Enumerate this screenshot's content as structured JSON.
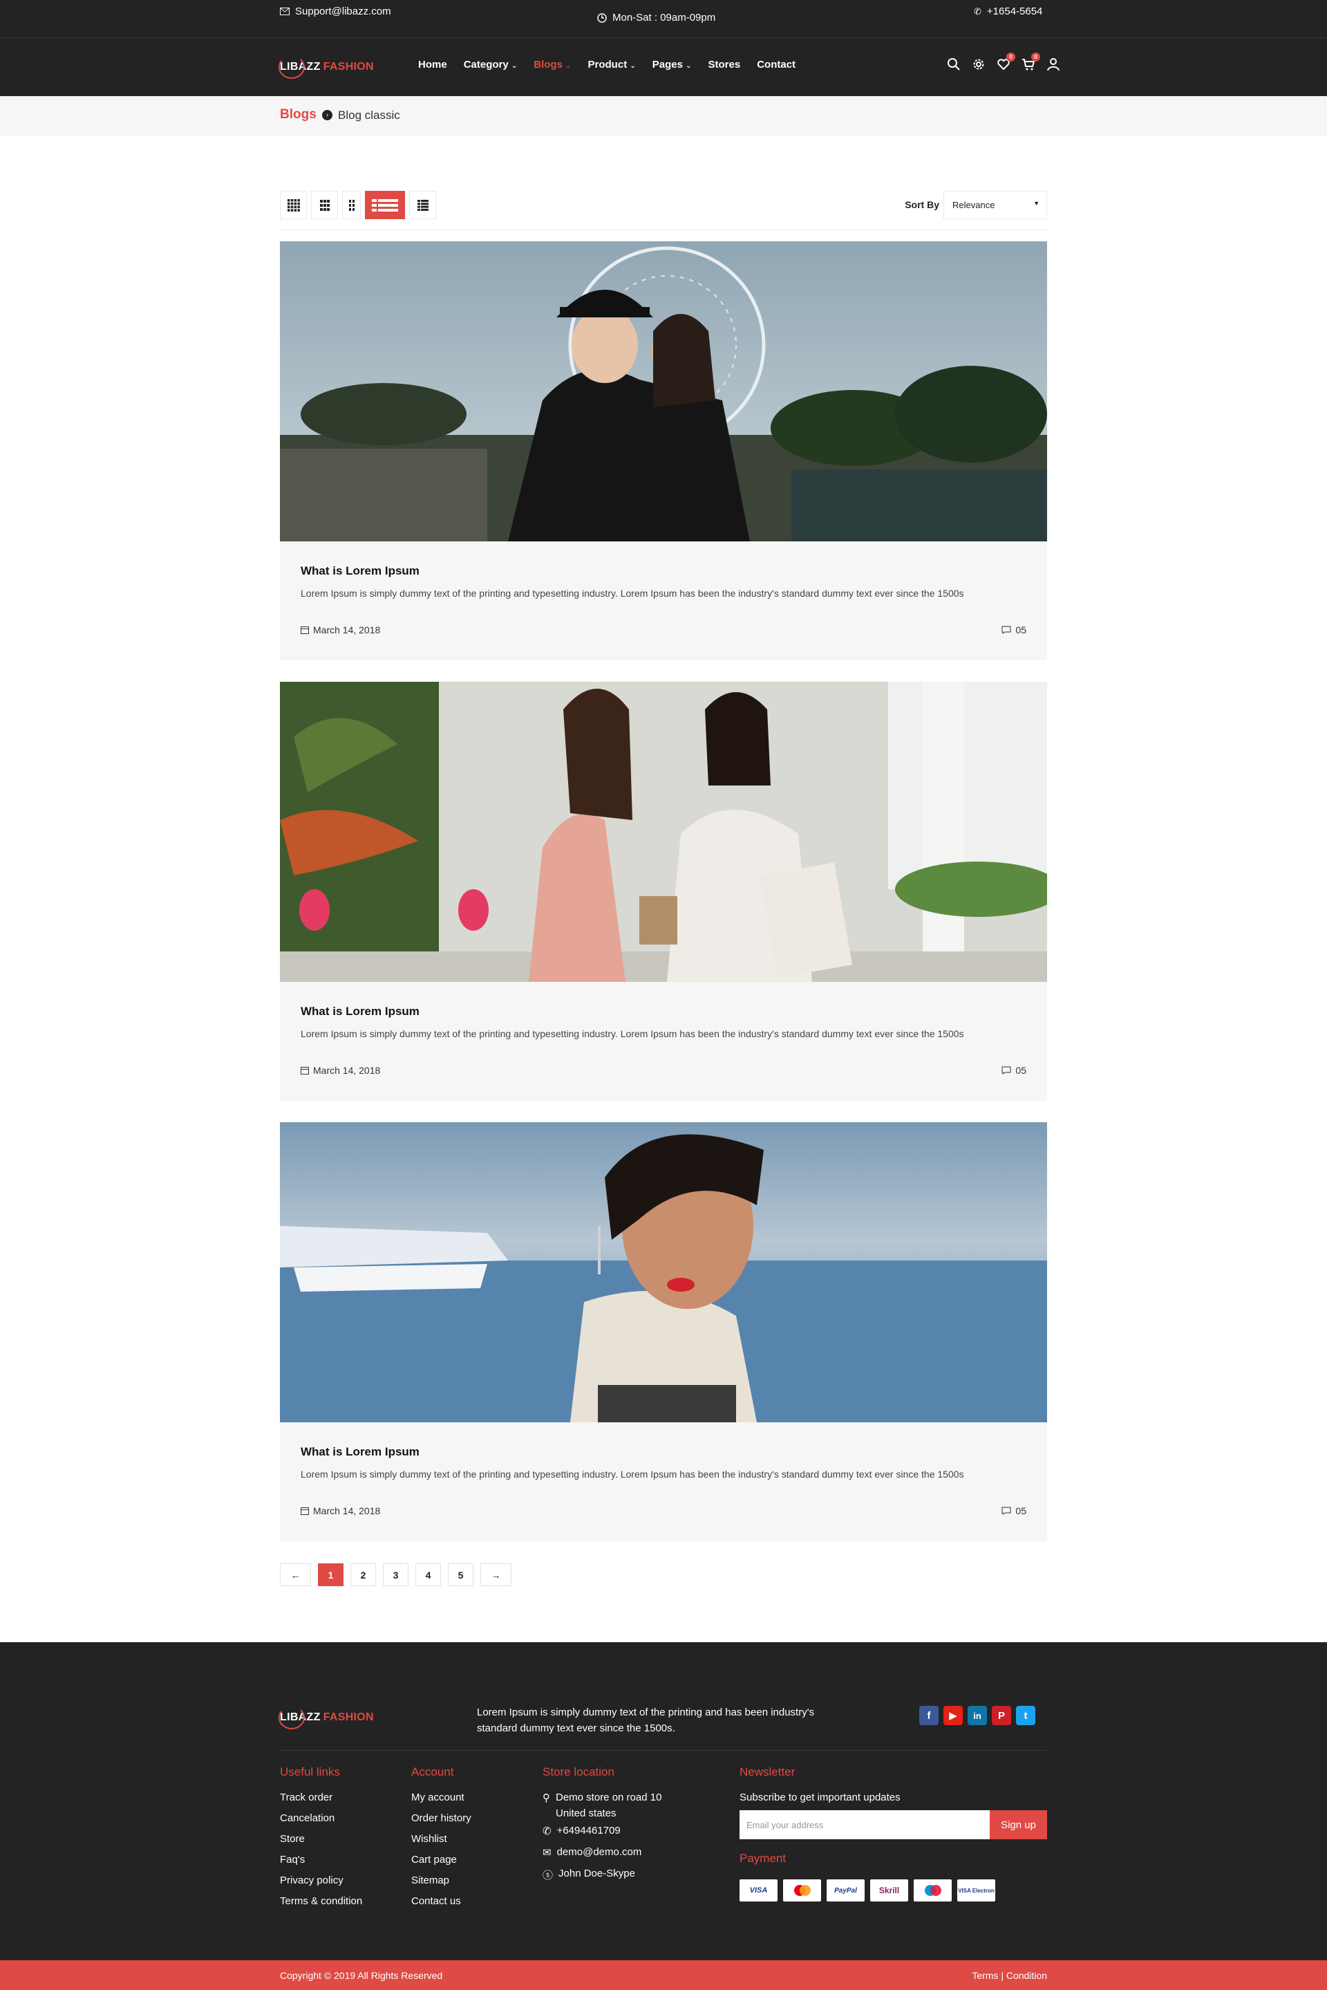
{
  "topbar": {
    "email": "Support@libazz.com",
    "hours": "Mon-Sat : 09am-09pm",
    "phone": "+1654-5654"
  },
  "brand": {
    "name_part1": "LIBAZZ",
    "name_part2": "FASHION"
  },
  "nav": {
    "items": [
      {
        "label": "Home",
        "dropdown": false
      },
      {
        "label": "Category",
        "dropdown": true
      },
      {
        "label": "Blogs",
        "dropdown": true,
        "active": true
      },
      {
        "label": "Product",
        "dropdown": true
      },
      {
        "label": "Pages",
        "dropdown": true
      },
      {
        "label": "Stores",
        "dropdown": false
      },
      {
        "label": "Contact",
        "dropdown": false
      }
    ],
    "wishlist_count": "0",
    "cart_count": "0"
  },
  "breadcrumb": {
    "parent": "Blogs",
    "current": "Blog classic"
  },
  "toolbar": {
    "sort_label": "Sort By",
    "sort_value": "Relevance",
    "active_view": "list"
  },
  "posts": [
    {
      "title": "What is Lorem Ipsum",
      "excerpt": "Lorem Ipsum is simply dummy text of the printing and typesetting industry. Lorem Ipsum has been the industry's standard dummy text ever since the 1500s",
      "date": "March 14, 2018",
      "comments": "05"
    },
    {
      "title": "What is Lorem Ipsum",
      "excerpt": "Lorem Ipsum is simply dummy text of the printing and typesetting industry. Lorem Ipsum has been the industry's standard dummy text ever since the 1500s",
      "date": "March 14, 2018",
      "comments": "05"
    },
    {
      "title": "What is Lorem Ipsum",
      "excerpt": "Lorem Ipsum is simply dummy text of the printing and typesetting industry. Lorem Ipsum has been the industry's standard dummy text ever since the 1500s",
      "date": "March 14, 2018",
      "comments": "05"
    }
  ],
  "pagination": {
    "prev": "←",
    "pages": [
      "1",
      "2",
      "3",
      "4",
      "5"
    ],
    "current": "1",
    "next": "→"
  },
  "footer": {
    "about": "Lorem Ipsum is simply dummy text of the printing and has been industry's standard dummy text ever since the 1500s.",
    "social": [
      "facebook-icon",
      "youtube-icon",
      "linkedin-icon",
      "pinterest-icon",
      "twitter-icon"
    ],
    "useful_links": {
      "title": "Useful links",
      "items": [
        "Track order",
        "Cancelation",
        "Store",
        "Faq's",
        "Privacy policy",
        "Terms & condition"
      ]
    },
    "account": {
      "title": "Account",
      "items": [
        "My account",
        "Order history",
        "Wishlist",
        "Cart page",
        "Sitemap",
        "Contact us"
      ]
    },
    "store": {
      "title": "Store location",
      "address_line1": "Demo store on road 10",
      "address_line2": "United states",
      "phone": "+6494461709",
      "email": "demo@demo.com",
      "skype": "John Doe-Skype"
    },
    "newsletter": {
      "title": "Newsletter",
      "subtitle": "Subscribe to get important updates",
      "placeholder": "Email your address",
      "button": "Sign up"
    },
    "payment": {
      "title": "Payment",
      "methods": [
        "VISA",
        "MasterCard",
        "PayPal",
        "Skrill",
        "Maestro",
        "VISA Electron"
      ]
    }
  },
  "copyright": {
    "left": "Copyright © 2019 All Rights Reserved",
    "right": "Terms | Condition"
  },
  "colors": {
    "accent": "#e04a44",
    "dark": "#232323",
    "panel": "#f6f6f6"
  }
}
